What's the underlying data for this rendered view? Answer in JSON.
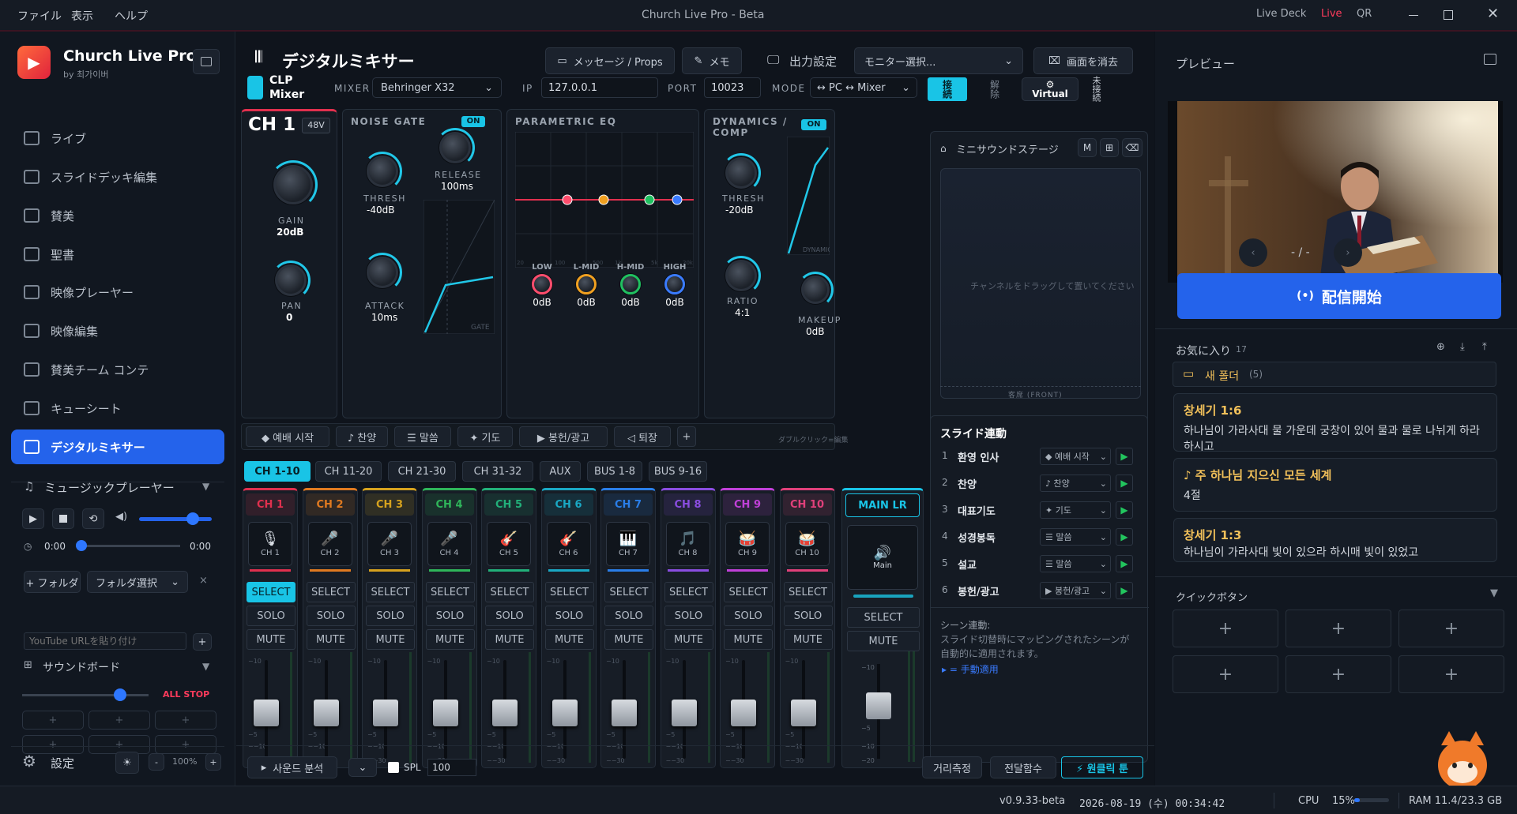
{
  "window": {
    "title": "Church Live Pro - Beta",
    "menu": [
      "ファイル",
      "表示",
      "ヘルプ"
    ],
    "live_deck": "Live Deck",
    "live": "Live",
    "qr": "QR",
    "live_color": "#ff3b5c"
  },
  "sidebar": {
    "app_name": "Church Live Pro",
    "by": "by 최가이버",
    "items": [
      {
        "label": "ライブ",
        "icon": "camera-icon"
      },
      {
        "label": "スライドデッキ編集",
        "icon": "monitor-icon"
      },
      {
        "label": "賛美",
        "icon": "music-icon"
      },
      {
        "label": "聖書",
        "icon": "book-icon"
      },
      {
        "label": "映像プレーヤー",
        "icon": "play-icon"
      },
      {
        "label": "映像編集",
        "icon": "film-icon"
      },
      {
        "label": "賛美チーム コンテ",
        "icon": "note-icon"
      },
      {
        "label": "キューシート",
        "icon": "list-icon"
      },
      {
        "label": "デジタルミキサー",
        "icon": "mixer-icon",
        "active": true
      }
    ],
    "music_player": {
      "title": "ミュージックプレーヤー",
      "time_start": "0:00",
      "time_end": "0:00",
      "add_folder": "+ フォルダ",
      "folder_select": "フォルダ選択",
      "url_placeholder": "YouTube URLを貼り付け"
    },
    "soundboard": {
      "title": "サウンドボード",
      "all_stop": "ALL STOP",
      "volume": 0.6
    },
    "settings": "設定",
    "zoom": "100%",
    "accent": "#2463eb"
  },
  "header": {
    "title": "デジタルミキサー",
    "message_btn": "メッセージ / Props",
    "memo_btn": "メモ",
    "output_label": "出力設定",
    "monitor_select": "モニター選択...",
    "clear_btn": "画面を消去"
  },
  "mixer_bar": {
    "logo1": "CLP",
    "logo2": "Mixer",
    "mixer_label": "MIXER",
    "mixer_value": "Behringer X32",
    "ip_label": "IP",
    "ip_value": "127.0.0.1",
    "port_label": "PORT",
    "port_value": "10023",
    "mode_label": "MODE",
    "mode_value": "↔ PC ↔ Mixer",
    "connect": "接続",
    "disconnect": "解除",
    "virtual": "Virtual",
    "status": "未接続"
  },
  "channel_detail": {
    "name": "CH 1",
    "phantom": "48V",
    "gain_label": "GAIN",
    "gain_value": "20dB",
    "pan_label": "PAN",
    "pan_value": "0"
  },
  "noise_gate": {
    "title": "NOISE GATE",
    "on": "ON",
    "thresh_label": "THRESH",
    "thresh_value": "-40dB",
    "release_label": "RELEASE",
    "release_value": "100ms",
    "attack_label": "ATTACK",
    "attack_value": "10ms",
    "graph_label": "GATE"
  },
  "eq": {
    "title": "PARAMETRIC EQ",
    "axis": [
      "20",
      "100",
      "500",
      "1k",
      "5k",
      "20k"
    ],
    "bands": [
      {
        "label": "LOW",
        "value": "0dB",
        "color": "#ff4d6d"
      },
      {
        "label": "L-MID",
        "value": "0dB",
        "color": "#f0a020"
      },
      {
        "label": "H-MID",
        "value": "0dB",
        "color": "#20c060"
      },
      {
        "label": "HIGH",
        "value": "0dB",
        "color": "#3a7bff"
      }
    ]
  },
  "dynamics": {
    "title1": "DYNAMICS /",
    "title2": "COMP",
    "on": "ON",
    "thresh_label": "THRESH",
    "thresh_value": "-20dB",
    "ratio_label": "RATIO",
    "ratio_value": "4:1",
    "makeup_label": "MAKEUP",
    "makeup_value": "0dB",
    "graph_label": "DYNAMICS"
  },
  "scenes": {
    "items": [
      "◆ 예배 시작",
      "♪ 찬양",
      "☰ 말씀",
      "✦ 기도",
      "▶ 봉헌/광고",
      "◁ 퇴장"
    ],
    "add": "+",
    "hint": "ダブルクリック=編集"
  },
  "bank_tabs": [
    "CH 1-10",
    "CH 11-20",
    "CH 21-30",
    "CH 31-32",
    "AUX",
    "BUS 1-8",
    "BUS 9-16"
  ],
  "channels": [
    {
      "name": "CH 1",
      "sub": "CH 1",
      "color": "#e0304e",
      "glyph": "🎙"
    },
    {
      "name": "CH 2",
      "sub": "CH 2",
      "color": "#e07a20",
      "glyph": "🎤"
    },
    {
      "name": "CH 3",
      "sub": "CH 3",
      "color": "#d6a21e",
      "glyph": "🎤"
    },
    {
      "name": "CH 4",
      "sub": "CH 4",
      "color": "#2fb55a",
      "glyph": "🎤"
    },
    {
      "name": "CH 5",
      "sub": "CH 5",
      "color": "#22b07a",
      "glyph": "🎸"
    },
    {
      "name": "CH 6",
      "sub": "CH 6",
      "color": "#1aa8c4",
      "glyph": "🎸"
    },
    {
      "name": "CH 7",
      "sub": "CH 7",
      "color": "#2a7ee8",
      "glyph": "🎹"
    },
    {
      "name": "CH 8",
      "sub": "CH 8",
      "color": "#8a4de0",
      "glyph": "🎵"
    },
    {
      "name": "CH 9",
      "sub": "CH 9",
      "color": "#c040d8",
      "glyph": "🥁"
    },
    {
      "name": "CH 10",
      "sub": "CH 10",
      "color": "#e0407a",
      "glyph": "🥁"
    }
  ],
  "strip_buttons": {
    "select": "SELECT",
    "solo": "SOLO",
    "mute": "MUTE",
    "scale": [
      "−10",
      "−5",
      "−−10",
      "−−30"
    ]
  },
  "main_lr": {
    "title": "MAIN LR",
    "sub": "Main",
    "select": "SELECT",
    "mute": "MUTE",
    "scale": [
      "−10",
      "−5",
      "−10",
      "−20"
    ]
  },
  "mini_stage": {
    "title": "ミニサウンドステージ",
    "m": "M",
    "hint": "チャンネルをドラッグして置いてください",
    "front": "客席 (FRONT)"
  },
  "slide_link": {
    "title": "スライド連動",
    "rows": [
      {
        "n": "1",
        "name": "환영 인사",
        "scene": "◆ 예배 시작"
      },
      {
        "n": "2",
        "name": "찬양",
        "scene": "♪ 찬양"
      },
      {
        "n": "3",
        "name": "대표기도",
        "scene": "✦ 기도"
      },
      {
        "n": "4",
        "name": "성경봉독",
        "scene": "☰ 말씀"
      },
      {
        "n": "5",
        "name": "설교",
        "scene": "☰ 말씀"
      },
      {
        "n": "6",
        "name": "봉헌/광고",
        "scene": "▶ 봉헌/광고"
      }
    ],
    "scene_title": "シーン連動:",
    "scene_desc": "スライド切替時にマッピングされたシーンが自動的に適用されます。",
    "manual": "▸ = 手動適用"
  },
  "bottom": {
    "analysis": "사운드 분석",
    "spl": "SPL",
    "spl_value": "100",
    "distance": "거리측정",
    "transfer": "전달함수",
    "one_click": "⚡ 원클릭 툰"
  },
  "preview": {
    "title": "プレビュー",
    "counter": "- / -",
    "broadcast": "配信開始"
  },
  "favorites": {
    "title": "お気に入り",
    "count": "17",
    "folder": "새 폴더",
    "folder_count": "(5)",
    "items": [
      {
        "title": "창세기 1:6",
        "body": "하나님이 가라사대 물 가운데 궁창이 있어 물과 물로 나뉘게 하라 하시고"
      },
      {
        "title": "♪ 주 하나님 지으신 모든 세계",
        "body": "4절"
      },
      {
        "title": "창세기 1:3",
        "body": "하나님이 가라사대 빛이 있으라 하시매 빛이 있었고"
      }
    ]
  },
  "quick": {
    "title": "クイックボタン"
  },
  "status": {
    "version": "v0.9.33-beta",
    "datetime": "2026-08-19 (수) 00:34:42",
    "cpu_label": "CPU",
    "cpu_value": "15%",
    "cpu_level": 0.15,
    "ram": "RAM 11.4/23.3 GB"
  }
}
